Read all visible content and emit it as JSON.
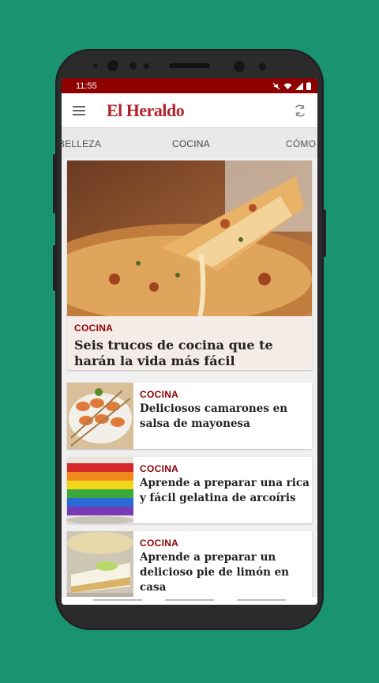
{
  "status": {
    "time": "11:55"
  },
  "app": {
    "logo": "El Heraldo"
  },
  "tabs": [
    "BELLEZA",
    "COCINA",
    "CÓMO HA"
  ],
  "hero": {
    "category": "COCINA",
    "title": "Seis trucos de cocina que te harán la vida más fácil"
  },
  "articles": [
    {
      "category": "COCINA",
      "title": "Deliciosos camarones en salsa de mayonesa"
    },
    {
      "category": "COCINA",
      "title": "Aprende a preparar una rica y fácil gelatina de arcoíris"
    },
    {
      "category": "COCINA",
      "title": "Aprende a preparar un delicioso pie de limón en casa"
    }
  ],
  "colors": {
    "background": "#1a9470",
    "status_bar": "#8f0000",
    "brand": "#b3232b",
    "category": "#8f0000"
  }
}
